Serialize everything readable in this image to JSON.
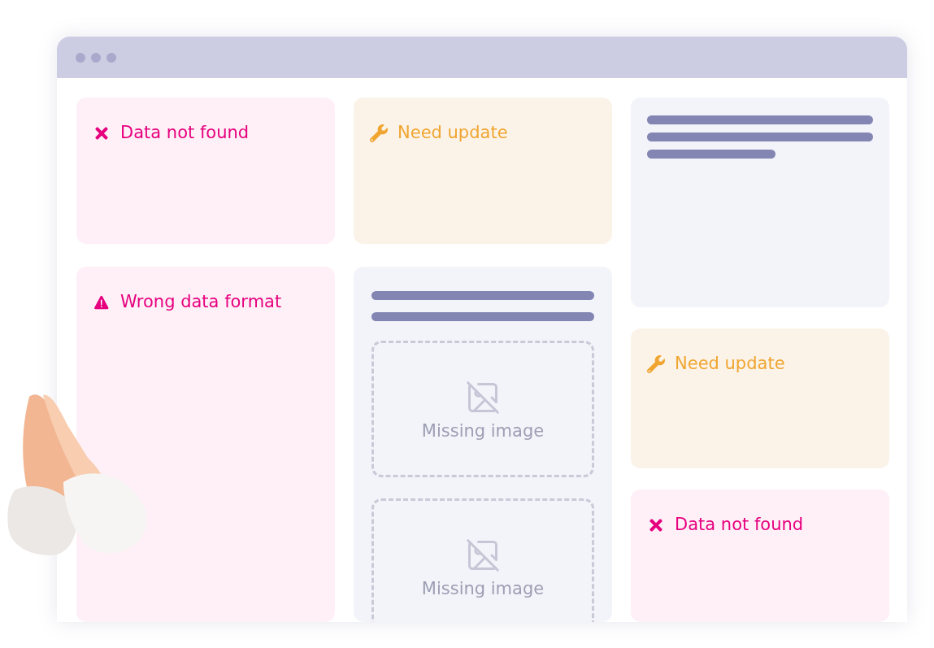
{
  "columns": [
    [
      {
        "kind": "error",
        "title": "Data not found"
      },
      {
        "kind": "warning",
        "title": "Wrong data format"
      }
    ],
    [
      {
        "kind": "update",
        "title": "Need update"
      },
      {
        "kind": "media",
        "placeholders": [
          {
            "label": "Missing image"
          },
          {
            "label": "Missing image"
          }
        ]
      }
    ],
    [
      {
        "kind": "text"
      },
      {
        "kind": "update",
        "title": "Need update"
      },
      {
        "kind": "error",
        "title": "Data not found"
      }
    ]
  ]
}
